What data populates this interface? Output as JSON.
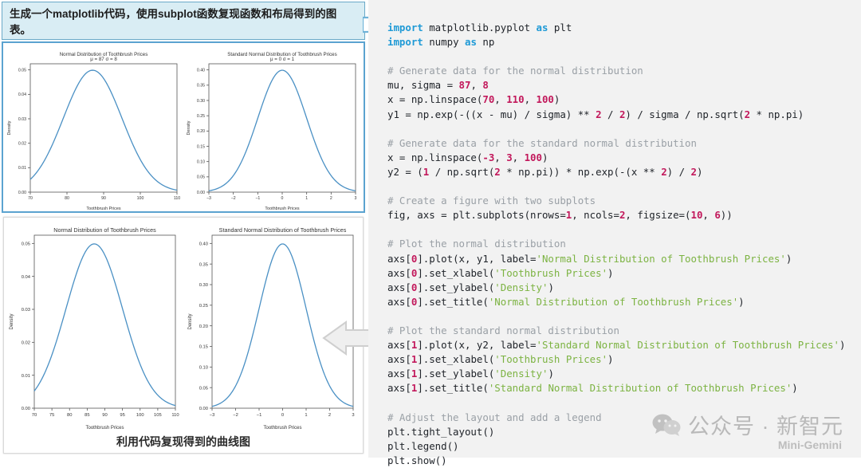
{
  "prompt": {
    "text": "生成一个matplotlib代码，使用subplot函数复现函数和布局得到的图表。"
  },
  "arrows": {
    "right": "arrow-right-icon",
    "left": "arrow-left-icon"
  },
  "reference_panel": {
    "caption": ""
  },
  "reproduced_panel": {
    "caption": "利用代码复现得到的曲线图"
  },
  "watermark": {
    "logo": "wechat-icon",
    "text": "公众号 · 新智元",
    "subtext": "Mini-Gemini"
  },
  "chart_data": [
    {
      "id": "ref-normal",
      "type": "line",
      "title": "Normal Distribution of Toothbrush Prices",
      "subtitle": "μ = 87 σ = 8",
      "xlabel": "Toothbrush Prices",
      "ylabel": "Density",
      "xlim": [
        70,
        110
      ],
      "ylim": [
        0.0,
        0.0525
      ],
      "xticks": [
        70,
        80,
        90,
        100,
        110
      ],
      "yticks": [
        0.0,
        0.01,
        0.02,
        0.03,
        0.04,
        0.05
      ],
      "ytick_labels": [
        "0.00",
        "0.01",
        "0.02",
        "0.03",
        "0.04",
        "0.05"
      ],
      "grid": false,
      "legend": "none",
      "series": [
        {
          "name": "Normal Distribution of Toothbrush Prices",
          "color": "#4a90c4",
          "distribution": "gaussian",
          "mu": 87,
          "sigma": 8,
          "x_start": 70,
          "x_end": 110,
          "points": 100
        }
      ]
    },
    {
      "id": "ref-standard-normal",
      "type": "line",
      "title": "Standard Normal Distribution of Toothbrush Prices",
      "subtitle": "μ = 0 σ = 1",
      "xlabel": "Toothbrush Prices",
      "ylabel": "Density",
      "xlim": [
        -3,
        3
      ],
      "ylim": [
        0.0,
        0.42
      ],
      "xticks": [
        -3,
        -2,
        -1,
        0,
        1,
        2,
        3
      ],
      "xtick_labels": [
        "−3",
        "−2",
        "−1",
        "0",
        "1",
        "2",
        "3"
      ],
      "yticks": [
        0.0,
        0.05,
        0.1,
        0.15,
        0.2,
        0.25,
        0.3,
        0.35,
        0.4
      ],
      "ytick_labels": [
        "0.00",
        "0.05",
        "0.10",
        "0.15",
        "0.20",
        "0.25",
        "0.30",
        "0.35",
        "0.40"
      ],
      "grid": false,
      "legend": "none",
      "series": [
        {
          "name": "Standard Normal Distribution of Toothbrush Prices",
          "color": "#4a90c4",
          "distribution": "gaussian",
          "mu": 0,
          "sigma": 1,
          "x_start": -3,
          "x_end": 3,
          "points": 100
        }
      ]
    },
    {
      "id": "repro-normal",
      "type": "line",
      "title": "Normal Distribution of Toothbrush Prices",
      "subtitle": "",
      "xlabel": "Toothbrush Prices",
      "ylabel": "Density",
      "xlim": [
        70,
        110
      ],
      "ylim": [
        0.0,
        0.0525
      ],
      "xticks": [
        70,
        75,
        80,
        85,
        90,
        95,
        100,
        105,
        110
      ],
      "yticks": [
        0.0,
        0.01,
        0.02,
        0.03,
        0.04,
        0.05
      ],
      "ytick_labels": [
        "0.00",
        "0.01",
        "0.02",
        "0.03",
        "0.04",
        "0.05"
      ],
      "grid": false,
      "legend": "none",
      "series": [
        {
          "name": "Normal Distribution of Toothbrush Prices",
          "color": "#4a90c4",
          "distribution": "gaussian",
          "mu": 87,
          "sigma": 8,
          "x_start": 70,
          "x_end": 110,
          "points": 100
        }
      ]
    },
    {
      "id": "repro-standard-normal",
      "type": "line",
      "title": "Standard Normal Distribution of Toothbrush Prices",
      "subtitle": "",
      "xlabel": "Toothbrush Prices",
      "ylabel": "Density",
      "xlim": [
        -3,
        3
      ],
      "ylim": [
        0.0,
        0.42
      ],
      "xticks": [
        -3,
        -2,
        -1,
        0,
        1,
        2,
        3
      ],
      "xtick_labels": [
        "−3",
        "−2",
        "−1",
        "0",
        "1",
        "2",
        "3"
      ],
      "yticks": [
        0.0,
        0.05,
        0.1,
        0.15,
        0.2,
        0.25,
        0.3,
        0.35,
        0.4
      ],
      "ytick_labels": [
        "0.00",
        "0.05",
        "0.10",
        "0.15",
        "0.20",
        "0.25",
        "0.30",
        "0.35",
        "0.40"
      ],
      "grid": false,
      "legend": "none",
      "series": [
        {
          "name": "Standard Normal Distribution of Toothbrush Prices",
          "color": "#4a90c4",
          "distribution": "gaussian",
          "mu": 0,
          "sigma": 1,
          "x_start": -3,
          "x_end": 3,
          "points": 100
        }
      ]
    }
  ],
  "code": {
    "language": "python",
    "lines": [
      [
        [
          "kw",
          "import"
        ],
        [
          "pl",
          " matplotlib.pyplot "
        ],
        [
          "kw",
          "as"
        ],
        [
          "pl",
          " plt"
        ]
      ],
      [
        [
          "kw",
          "import"
        ],
        [
          "pl",
          " numpy "
        ],
        [
          "kw",
          "as"
        ],
        [
          "pl",
          " np"
        ]
      ],
      [],
      [
        [
          "cm",
          "# Generate data for the normal distribution"
        ]
      ],
      [
        [
          "pl",
          "mu, sigma = "
        ],
        [
          "num",
          "87"
        ],
        [
          "pl",
          ", "
        ],
        [
          "num",
          "8"
        ]
      ],
      [
        [
          "pl",
          "x = np.linspace("
        ],
        [
          "num",
          "70"
        ],
        [
          "pl",
          ", "
        ],
        [
          "num",
          "110"
        ],
        [
          "pl",
          ", "
        ],
        [
          "num",
          "100"
        ],
        [
          "pl",
          ")"
        ]
      ],
      [
        [
          "pl",
          "y1 = np.exp(-((x - mu) / sigma) ** "
        ],
        [
          "num",
          "2"
        ],
        [
          "pl",
          " / "
        ],
        [
          "num",
          "2"
        ],
        [
          "pl",
          ") / sigma / np.sqrt("
        ],
        [
          "num",
          "2"
        ],
        [
          "pl",
          " * np.pi)"
        ]
      ],
      [],
      [
        [
          "cm",
          "# Generate data for the standard normal distribution"
        ]
      ],
      [
        [
          "pl",
          "x = np.linspace("
        ],
        [
          "num",
          "-3"
        ],
        [
          "pl",
          ", "
        ],
        [
          "num",
          "3"
        ],
        [
          "pl",
          ", "
        ],
        [
          "num",
          "100"
        ],
        [
          "pl",
          ")"
        ]
      ],
      [
        [
          "pl",
          "y2 = ("
        ],
        [
          "num",
          "1"
        ],
        [
          "pl",
          " / np.sqrt("
        ],
        [
          "num",
          "2"
        ],
        [
          "pl",
          " * np.pi)) * np.exp(-(x ** "
        ],
        [
          "num",
          "2"
        ],
        [
          "pl",
          ") / "
        ],
        [
          "num",
          "2"
        ],
        [
          "pl",
          ")"
        ]
      ],
      [],
      [
        [
          "cm",
          "# Create a figure with two subplots"
        ]
      ],
      [
        [
          "pl",
          "fig, axs = plt.subplots(nrows="
        ],
        [
          "num",
          "1"
        ],
        [
          "pl",
          ", ncols="
        ],
        [
          "num",
          "2"
        ],
        [
          "pl",
          ", figsize=("
        ],
        [
          "num",
          "10"
        ],
        [
          "pl",
          ", "
        ],
        [
          "num",
          "6"
        ],
        [
          "pl",
          "))"
        ]
      ],
      [],
      [
        [
          "cm",
          "# Plot the normal distribution"
        ]
      ],
      [
        [
          "pl",
          "axs["
        ],
        [
          "num",
          "0"
        ],
        [
          "pl",
          "].plot(x, y1, label="
        ],
        [
          "str",
          "'Normal Distribution of Toothbrush Prices'"
        ],
        [
          "pl",
          ")"
        ]
      ],
      [
        [
          "pl",
          "axs["
        ],
        [
          "num",
          "0"
        ],
        [
          "pl",
          "].set_xlabel("
        ],
        [
          "str",
          "'Toothbrush Prices'"
        ],
        [
          "pl",
          ")"
        ]
      ],
      [
        [
          "pl",
          "axs["
        ],
        [
          "num",
          "0"
        ],
        [
          "pl",
          "].set_ylabel("
        ],
        [
          "str",
          "'Density'"
        ],
        [
          "pl",
          ")"
        ]
      ],
      [
        [
          "pl",
          "axs["
        ],
        [
          "num",
          "0"
        ],
        [
          "pl",
          "].set_title("
        ],
        [
          "str",
          "'Normal Distribution of Toothbrush Prices'"
        ],
        [
          "pl",
          ")"
        ]
      ],
      [],
      [
        [
          "cm",
          "# Plot the standard normal distribution"
        ]
      ],
      [
        [
          "pl",
          "axs["
        ],
        [
          "num",
          "1"
        ],
        [
          "pl",
          "].plot(x, y2, label="
        ],
        [
          "str",
          "'Standard Normal Distribution of Toothbrush Prices'"
        ],
        [
          "pl",
          ")"
        ]
      ],
      [
        [
          "pl",
          "axs["
        ],
        [
          "num",
          "1"
        ],
        [
          "pl",
          "].set_xlabel("
        ],
        [
          "str",
          "'Toothbrush Prices'"
        ],
        [
          "pl",
          ")"
        ]
      ],
      [
        [
          "pl",
          "axs["
        ],
        [
          "num",
          "1"
        ],
        [
          "pl",
          "].set_ylabel("
        ],
        [
          "str",
          "'Density'"
        ],
        [
          "pl",
          ")"
        ]
      ],
      [
        [
          "pl",
          "axs["
        ],
        [
          "num",
          "1"
        ],
        [
          "pl",
          "].set_title("
        ],
        [
          "str",
          "'Standard Normal Distribution of Toothbrush Prices'"
        ],
        [
          "pl",
          ")"
        ]
      ],
      [],
      [
        [
          "cm",
          "# Adjust the layout and add a legend"
        ]
      ],
      [
        [
          "pl",
          "plt.tight_layout()"
        ]
      ],
      [
        [
          "pl",
          "plt.legend()"
        ]
      ],
      [
        [
          "pl",
          "plt.show()"
        ]
      ]
    ]
  }
}
